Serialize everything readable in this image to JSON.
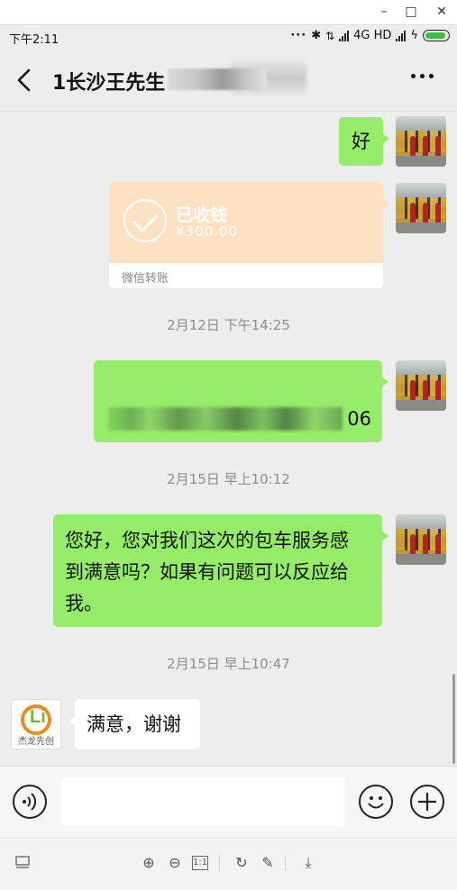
{
  "window": {
    "minimize": "–",
    "maximize": "□",
    "close": "✕"
  },
  "status_bar": {
    "time": "下午2:11",
    "dots": "···",
    "network": "4G HD"
  },
  "header": {
    "back_icon": "back-arrow-icon",
    "title": "1长沙王先生",
    "more_icon": "more-icon"
  },
  "messages": [
    {
      "type": "text",
      "side": "right",
      "text": "好"
    },
    {
      "type": "transfer",
      "side": "right",
      "title": "已收钱",
      "amount": "¥300.00",
      "footer": "微信转账"
    },
    {
      "type": "time",
      "text": "2月12日 下午14:25"
    },
    {
      "type": "text",
      "side": "right",
      "text": "06"
    },
    {
      "type": "time",
      "text": "2月15日 早上10:12"
    },
    {
      "type": "text",
      "side": "right",
      "lines": [
        "您好，您对我们这次的包车服务感",
        "到满意吗？如果有问题可以反应给",
        "我。"
      ]
    },
    {
      "type": "time",
      "text": "2月15日 早上10:47"
    },
    {
      "type": "text",
      "side": "left",
      "text": "满意，谢谢",
      "avatar_text": "杰龙先创"
    }
  ],
  "input_bar": {
    "voice_icon": "voice-icon",
    "emoji_icon": "emoji-icon",
    "plus_icon": "plus-icon"
  },
  "toolbar": {
    "zoom_in": "⊕",
    "zoom_out": "⊖",
    "actual_size": "1:1",
    "rotate": "↻",
    "edit": "✎",
    "download": "⤓"
  }
}
